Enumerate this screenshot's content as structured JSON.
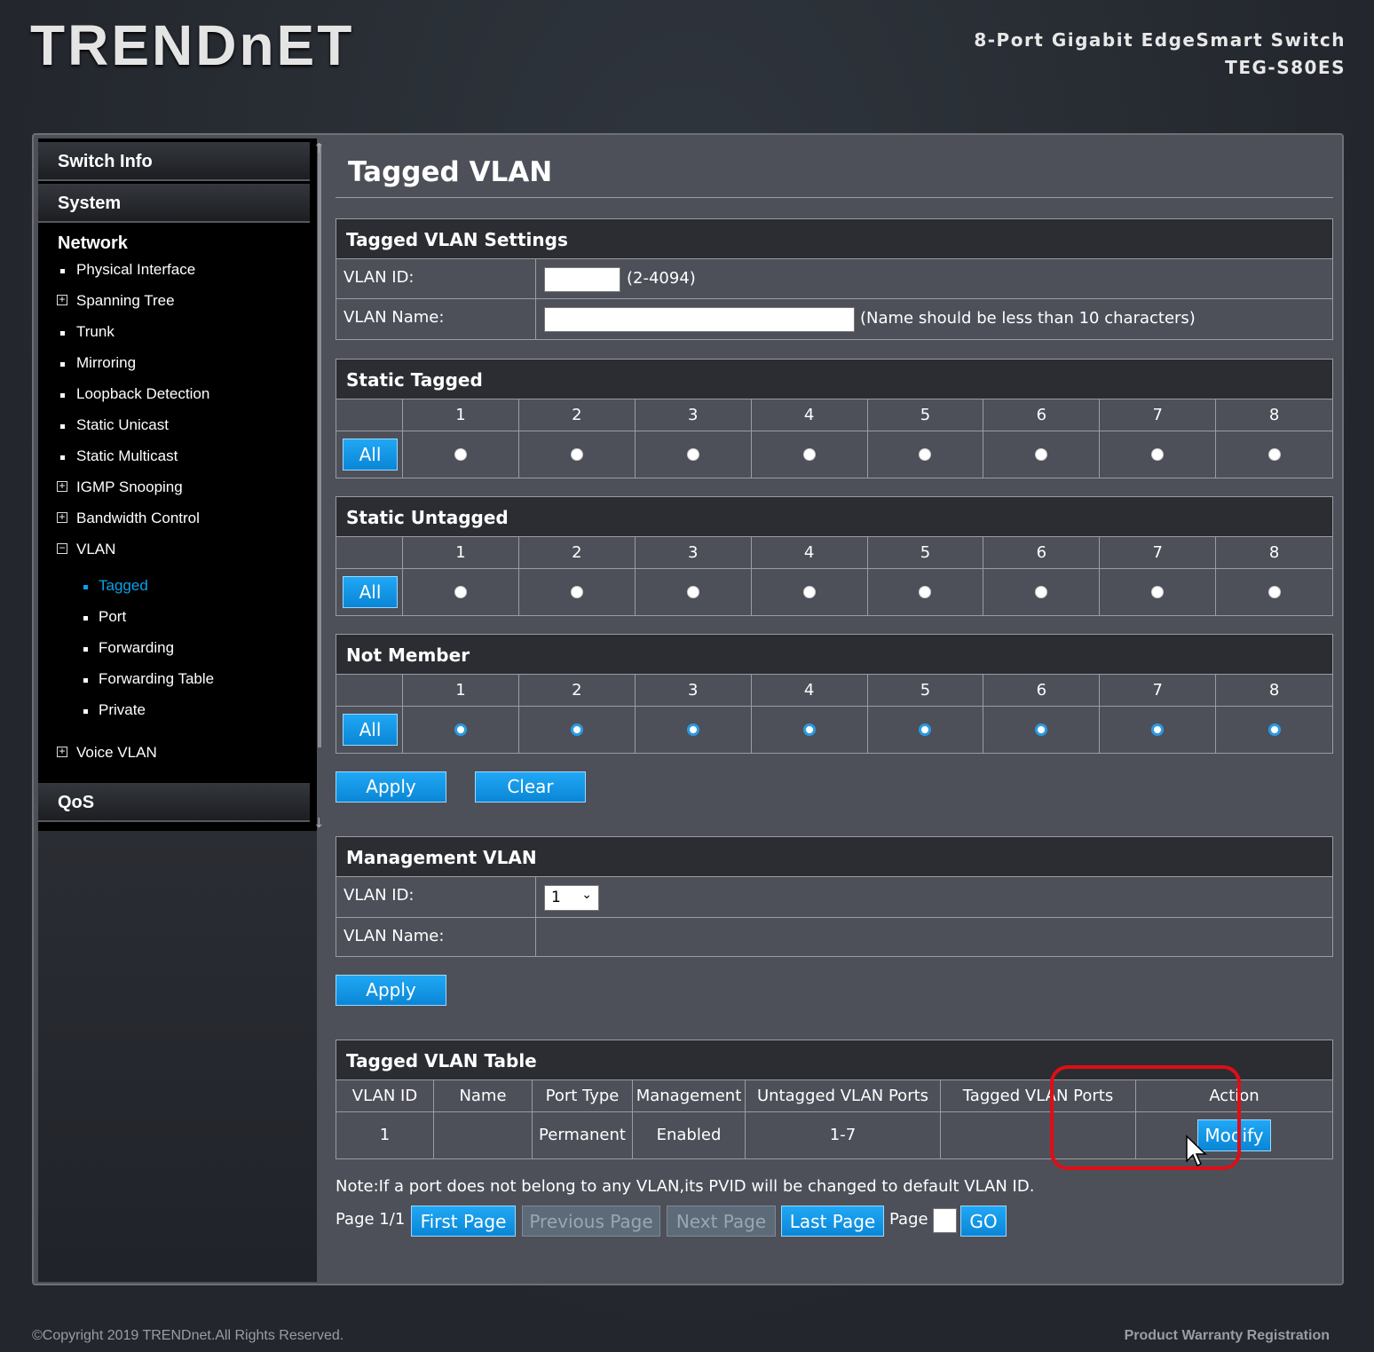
{
  "brand": {
    "logo": "TRENDnET"
  },
  "product": {
    "line1": "8-Port Gigabit EdgeSmart Switch",
    "line2": "TEG-S80ES"
  },
  "sidebar": {
    "switch_info": "Switch Info",
    "system": "System",
    "network": "Network",
    "items": [
      {
        "label": "Physical Interface"
      },
      {
        "label": "Spanning Tree"
      },
      {
        "label": "Trunk"
      },
      {
        "label": "Mirroring"
      },
      {
        "label": "Loopback Detection"
      },
      {
        "label": "Static Unicast"
      },
      {
        "label": "Static Multicast"
      },
      {
        "label": "IGMP Snooping"
      },
      {
        "label": "Bandwidth Control"
      },
      {
        "label": "VLAN"
      }
    ],
    "vlan_items": [
      {
        "label": "Tagged"
      },
      {
        "label": "Port"
      },
      {
        "label": "Forwarding"
      },
      {
        "label": "Forwarding Table"
      },
      {
        "label": "Private"
      }
    ],
    "voice_vlan": "Voice VLAN",
    "qos": "QoS"
  },
  "page": {
    "title": "Tagged VLAN"
  },
  "settings": {
    "header": "Tagged VLAN Settings",
    "vlan_id_label": "VLAN ID:",
    "vlan_id_value": "",
    "vlan_id_hint": "(2-4094)",
    "vlan_name_label": "VLAN Name:",
    "vlan_name_value": "",
    "vlan_name_hint": "(Name should be less than 10 characters)"
  },
  "ports": [
    "1",
    "2",
    "3",
    "4",
    "5",
    "6",
    "7",
    "8"
  ],
  "static_tagged": {
    "header": "Static Tagged",
    "all": "All"
  },
  "static_untagged": {
    "header": "Static Untagged",
    "all": "All"
  },
  "not_member": {
    "header": "Not Member",
    "all": "All"
  },
  "actions": {
    "apply": "Apply",
    "clear": "Clear"
  },
  "management": {
    "header": "Management VLAN",
    "vlan_id_label": "VLAN ID:",
    "vlan_id_selected": "1",
    "vlan_name_label": "VLAN Name:",
    "vlan_name_value": "",
    "apply": "Apply"
  },
  "table": {
    "header": "Tagged VLAN Table",
    "columns": [
      "VLAN ID",
      "Name",
      "Port Type",
      "Management",
      "Untagged VLAN Ports",
      "Tagged VLAN Ports",
      "Action"
    ],
    "rows": [
      {
        "vlan_id": "1",
        "name": "",
        "port_type": "Permanent",
        "management": "Enabled",
        "untagged": "1-7",
        "tagged": "",
        "action": "Modify"
      }
    ]
  },
  "note": "Note:If a port does not belong to any VLAN,its PVID will be changed to default VLAN ID.",
  "pager": {
    "page_info": "Page 1/1",
    "first": "First Page",
    "previous": "Previous Page",
    "next": "Next Page",
    "last": "Last Page",
    "page_label": "Page",
    "go": "GO"
  },
  "footer": {
    "copyright": "©Copyright 2019 TRENDnet.All Rights Reserved.",
    "warranty": "Product Warranty Registration"
  },
  "colors": {
    "accent": "#0aa2e8",
    "highlight": "#e00d16",
    "panel_bg": "#4d5059"
  }
}
